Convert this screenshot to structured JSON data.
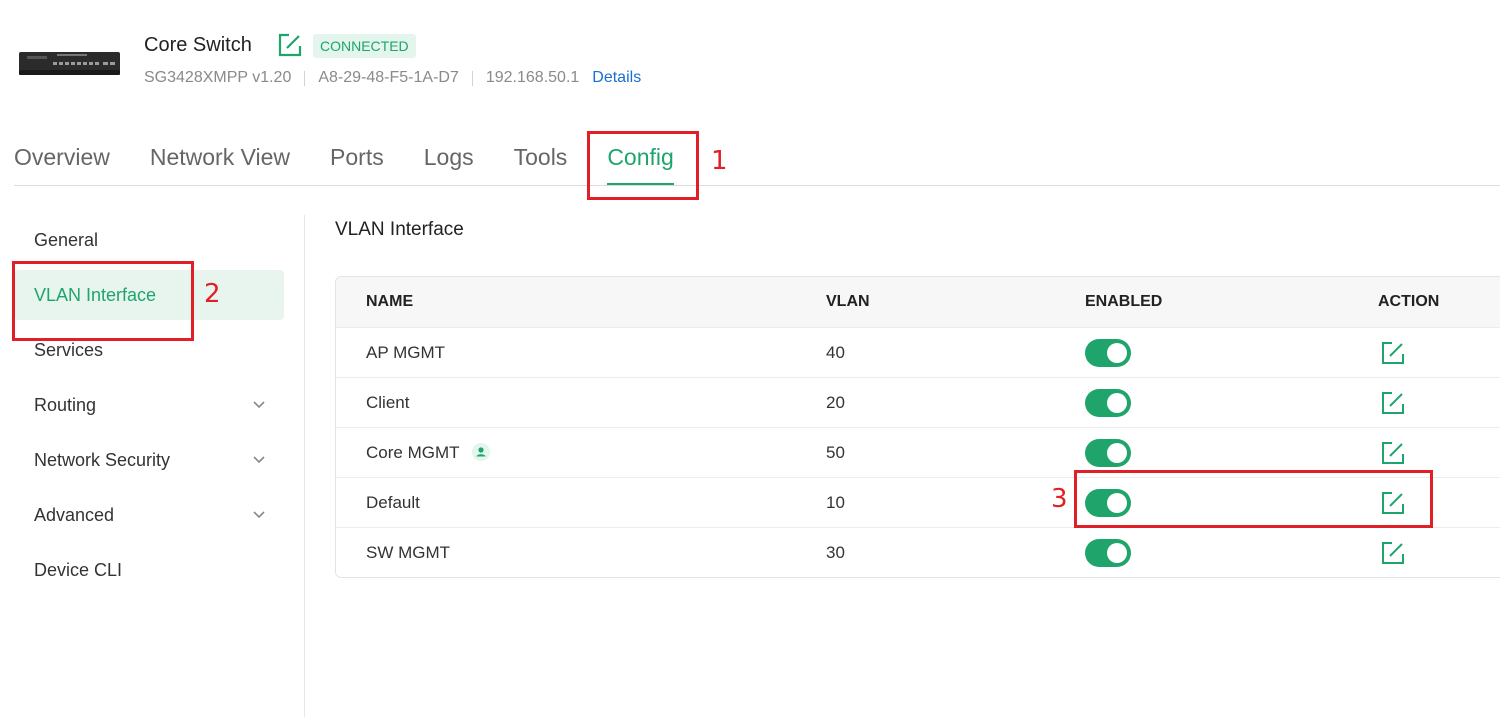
{
  "header": {
    "device_name": "Core Switch",
    "status": "CONNECTED",
    "model": "SG3428XMPP v1.20",
    "mac": "A8-29-48-F5-1A-D7",
    "ip": "192.168.50.1",
    "details_link": "Details"
  },
  "tabs": [
    {
      "label": "Overview",
      "active": false
    },
    {
      "label": "Network View",
      "active": false
    },
    {
      "label": "Ports",
      "active": false
    },
    {
      "label": "Logs",
      "active": false
    },
    {
      "label": "Tools",
      "active": false
    },
    {
      "label": "Config",
      "active": true
    }
  ],
  "sidebar": {
    "items": [
      {
        "label": "General",
        "active": false,
        "expandable": false
      },
      {
        "label": "VLAN Interface",
        "active": true,
        "expandable": false
      },
      {
        "label": "Services",
        "active": false,
        "expandable": false
      },
      {
        "label": "Routing",
        "active": false,
        "expandable": true
      },
      {
        "label": "Network Security",
        "active": false,
        "expandable": true
      },
      {
        "label": "Advanced",
        "active": false,
        "expandable": true
      },
      {
        "label": "Device CLI",
        "active": false,
        "expandable": false
      }
    ]
  },
  "main": {
    "title": "VLAN Interface",
    "table": {
      "columns": [
        "NAME",
        "VLAN",
        "ENABLED",
        "ACTION"
      ],
      "rows": [
        {
          "name": "AP MGMT",
          "vlan": "40",
          "enabled": true,
          "user_icon": false
        },
        {
          "name": "Client",
          "vlan": "20",
          "enabled": true,
          "user_icon": false
        },
        {
          "name": "Core MGMT",
          "vlan": "50",
          "enabled": true,
          "user_icon": true
        },
        {
          "name": "Default",
          "vlan": "10",
          "enabled": true,
          "user_icon": false
        },
        {
          "name": "SW MGMT",
          "vlan": "30",
          "enabled": true,
          "user_icon": false
        }
      ]
    }
  },
  "annotations": [
    "1",
    "2",
    "3"
  ],
  "colors": {
    "accent": "#1fa56b",
    "accent_light": "#e8f5ee",
    "annotation": "#e01f26",
    "link": "#1a6fd1"
  },
  "icons": {
    "edit": "edit-icon",
    "chevron": "chevron-down-icon",
    "user": "user-icon"
  }
}
